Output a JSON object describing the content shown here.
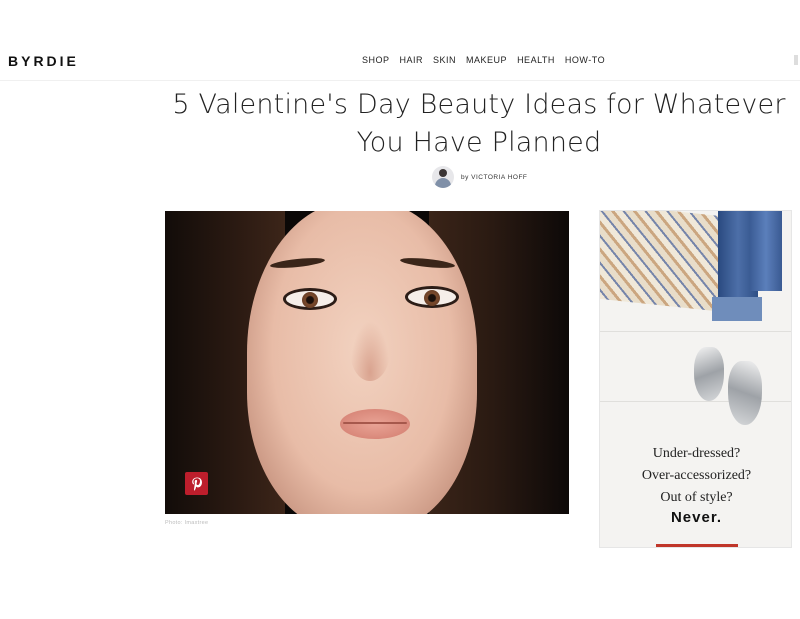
{
  "header": {
    "logo": "BYRDIE",
    "nav": [
      "SHOP",
      "HAIR",
      "SKIN",
      "MAKEUP",
      "HEALTH",
      "HOW-TO"
    ]
  },
  "article": {
    "title": "5 Valentine's Day Beauty Ideas for Whatever You Have Planned",
    "byline": "by VICTORIA HOFF",
    "photo_caption": "Photo: Imaxtree"
  },
  "ad": {
    "lines": [
      "Under-dressed?",
      "Over-accessorized?",
      "Out of style?"
    ],
    "cta": "Never."
  },
  "colors": {
    "pinterest": "#bd1e2c",
    "ad_bar": "#c0362a"
  },
  "icons": {
    "pin": "pinterest-icon",
    "author": "avatar"
  }
}
